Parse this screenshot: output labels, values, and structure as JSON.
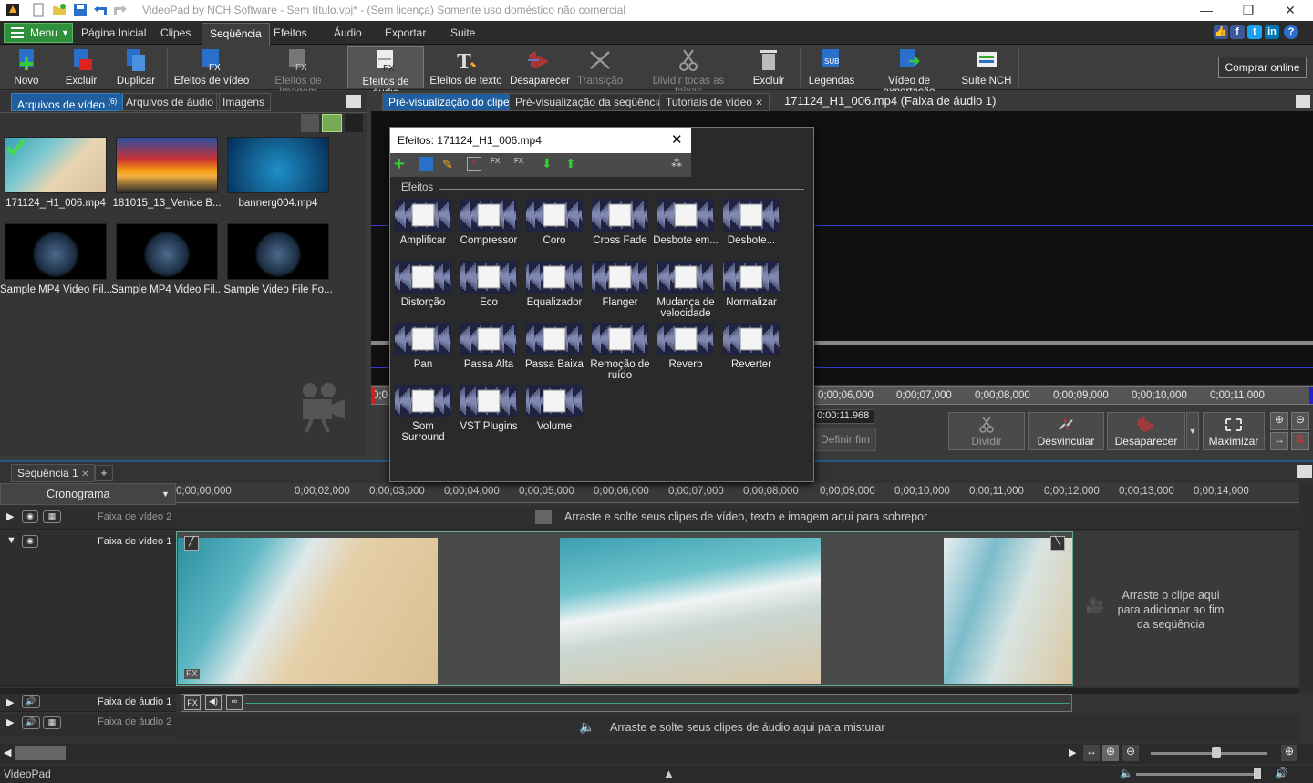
{
  "window": {
    "title": "VideoPad by NCH Software - Sem título.vpj* - (Sem licença) Somente uso doméstico não comercial",
    "minimize": "—",
    "maximize": "❐",
    "close": "✕"
  },
  "menubar": {
    "menu_label": "Menu",
    "tabs": [
      "Página Inicial",
      "Clipes",
      "Seqüência",
      "Efeitos",
      "Áudio",
      "Exportar",
      "Suite"
    ],
    "active_tab": "Seqüência"
  },
  "toolbar": {
    "novo": "Novo",
    "excluir": "Excluir",
    "duplicar": "Duplicar",
    "efeitos_video": "Efeitos de vídeo",
    "efeitos_imagem": "Efeitos de Imagem",
    "efeitos_audio": "Efeitos de áudio",
    "efeitos_texto": "Efeitos de texto",
    "desaparecer": "Desaparecer",
    "transicao": "Transição",
    "dividir_faixas": "Dividir todas as faixas",
    "excluir2": "Excluir",
    "legendas": "Legendas",
    "video_exportacao": "Vídeo de exportação",
    "suite_nch": "Suíte NCH",
    "comprar": "Comprar online"
  },
  "media": {
    "tabs": {
      "video": "Arquivos de vídeo",
      "video_count": "(6)",
      "audio": "Arquivos de áudio",
      "images": "Imagens"
    },
    "items": [
      "171124_H1_006.mp4",
      "181015_13_Venice B...",
      "bannerg004.mp4",
      "Sample MP4 Video Fil...",
      "Sample MP4 Video Fil...",
      "Sample Video File Fo..."
    ]
  },
  "preview": {
    "tabs": {
      "clip": "Pré-visualização do clipe",
      "seq": "Pré-visualização da seqüência",
      "tut": "Tutoriais de vídeo"
    },
    "title": "171124_H1_006.mp4 (Faixa de áudio 1)",
    "ruler": [
      "0;00;06,000",
      "0;00;07,000",
      "0;00;08,000",
      "0;00;09,000",
      "0;00;10,000",
      "0;00;11,000"
    ],
    "ruler_start": "0;0",
    "duration": "0:00:11.968",
    "define_end": "Definir fim",
    "buttons": {
      "split": "Dividir",
      "unlink": "Desvincular",
      "fade": "Desaparecer",
      "maximize": "Maximizar"
    }
  },
  "fx": {
    "title": "Efeitos: 171124_H1_006.mp4",
    "section": "Efeitos",
    "items": [
      "Amplificar",
      "Compressor",
      "Coro",
      "Cross Fade",
      "Desbote em...",
      "Desbote...",
      "Distorção",
      "Eco",
      "Equalizador",
      "Flanger",
      "Mudança de velocidade",
      "Normalizar",
      "Pan",
      "Passa Alta",
      "Passa Baixa",
      "Remoção de ruído",
      "Reverb",
      "Reverter",
      "Som Surround",
      "VST Plugins",
      "Volume"
    ]
  },
  "timeline": {
    "seq_tab": "Sequência 1",
    "mode": "Cronograma",
    "ruler": [
      "0;00;00,000",
      "0;00;02,000",
      "0;00;03,000",
      "0;00;04,000",
      "0;00;05,000",
      "0;00;06,000",
      "0;00;07,000",
      "0;00;08,000",
      "0;00;09,000",
      "0;00;10,000",
      "0;00;11,000",
      "0;00;12,000",
      "0;00;13,000",
      "0;00;14,000"
    ],
    "video2": "Faixa de vídeo 2",
    "video2_hint": "Arraste e solte seus clipes de vídeo, texto e imagem aqui para sobrepor",
    "video1": "Faixa de vídeo 1",
    "drop_hint": "Arraste o clipe aqui para adicionar ao fim da seqüência",
    "audio1": "Faixa de áudio 1",
    "audio2": "Faixa de áudio 2",
    "audio2_hint": "Arraste e solte seus clipes de áudio aqui para misturar",
    "fx_badge": "FX"
  },
  "status": {
    "app": "VideoPad"
  },
  "colors": {
    "accent": "#1f5f9f",
    "menu_green": "#2f8f3a",
    "bg": "#3a3a3a"
  }
}
